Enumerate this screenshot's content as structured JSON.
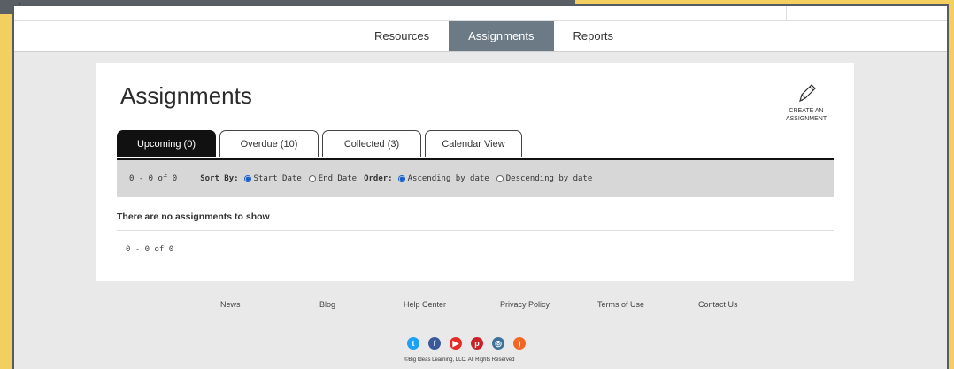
{
  "nav": {
    "tabs": [
      "Resources",
      "Assignments",
      "Reports"
    ],
    "active": "Assignments"
  },
  "page": {
    "title": "Assignments",
    "create_label_line1": "CREATE AN",
    "create_label_line2": "ASSIGNMENT"
  },
  "tabs": [
    {
      "label": "Upcoming (0)",
      "active": true
    },
    {
      "label": "Overdue (10)",
      "active": false
    },
    {
      "label": "Collected (3)",
      "active": false
    },
    {
      "label": "Calendar View",
      "active": false
    }
  ],
  "filter": {
    "count": "0 - 0 of 0",
    "sort_by_label": "Sort By:",
    "sort_options": [
      "Start Date",
      "End Date"
    ],
    "sort_selected": "Start Date",
    "order_label": "Order:",
    "order_options": [
      "Ascending by date",
      "Descending by date"
    ],
    "order_selected": "Ascending by date"
  },
  "empty_message": "There are no assignments to show",
  "bottom_count": "0 - 0 of 0",
  "footer": {
    "links": [
      "News",
      "Blog",
      "Help Center",
      "Privacy Policy",
      "Terms of Use",
      "Contact Us"
    ],
    "social": [
      {
        "name": "twitter-icon",
        "glyph": "t",
        "color": "#1da1f2"
      },
      {
        "name": "facebook-icon",
        "glyph": "f",
        "color": "#3b5998"
      },
      {
        "name": "youtube-icon",
        "glyph": "▶",
        "color": "#e52d27"
      },
      {
        "name": "pinterest-icon",
        "glyph": "p",
        "color": "#cb2027"
      },
      {
        "name": "instagram-icon",
        "glyph": "◎",
        "color": "#3f729b"
      },
      {
        "name": "rss-icon",
        "glyph": ")",
        "color": "#f26522"
      }
    ],
    "copyright": "©Big Ideas Learning, LLC. All Rights Reserved"
  }
}
